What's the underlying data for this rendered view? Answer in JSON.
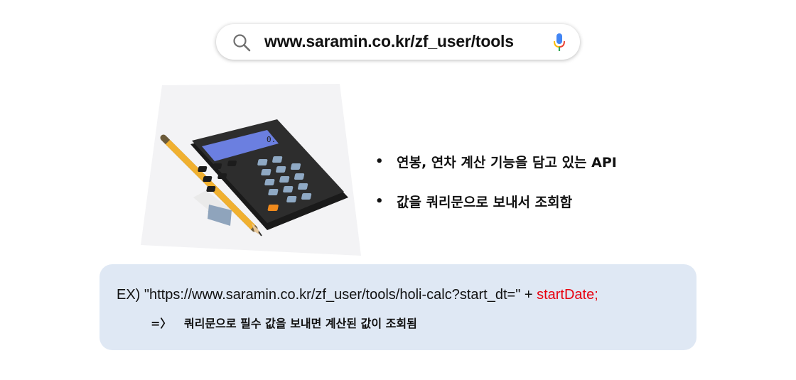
{
  "search": {
    "url": "www.saramin.co.kr/zf_user/tools",
    "left_icon": "search-icon",
    "right_icon": "microphone-icon"
  },
  "illustration": {
    "subject": "calculator-pencil-eraser",
    "calculator_display": "0."
  },
  "bullets": {
    "marker": "•",
    "items": [
      {
        "text": "연봉, 연차 계산 기능을 담고 있는 API"
      },
      {
        "text": "값을 쿼리문으로 보내서 조회함"
      }
    ]
  },
  "example": {
    "prefix": "EX) \"https://www.saramin.co.kr/zf_user/tools/holi-calc?start_dt=\" + ",
    "highlight": "startDate;",
    "arrow": "=〉",
    "result": "쿼리문으로 필수 값을 보내면 계산된 값이 조회됨"
  },
  "colors": {
    "highlight": "#e8000f",
    "example_bg": "#dfe8f4",
    "calculator_display": "#6b7fe0",
    "calculator_accent_key": "#f08a1c"
  }
}
